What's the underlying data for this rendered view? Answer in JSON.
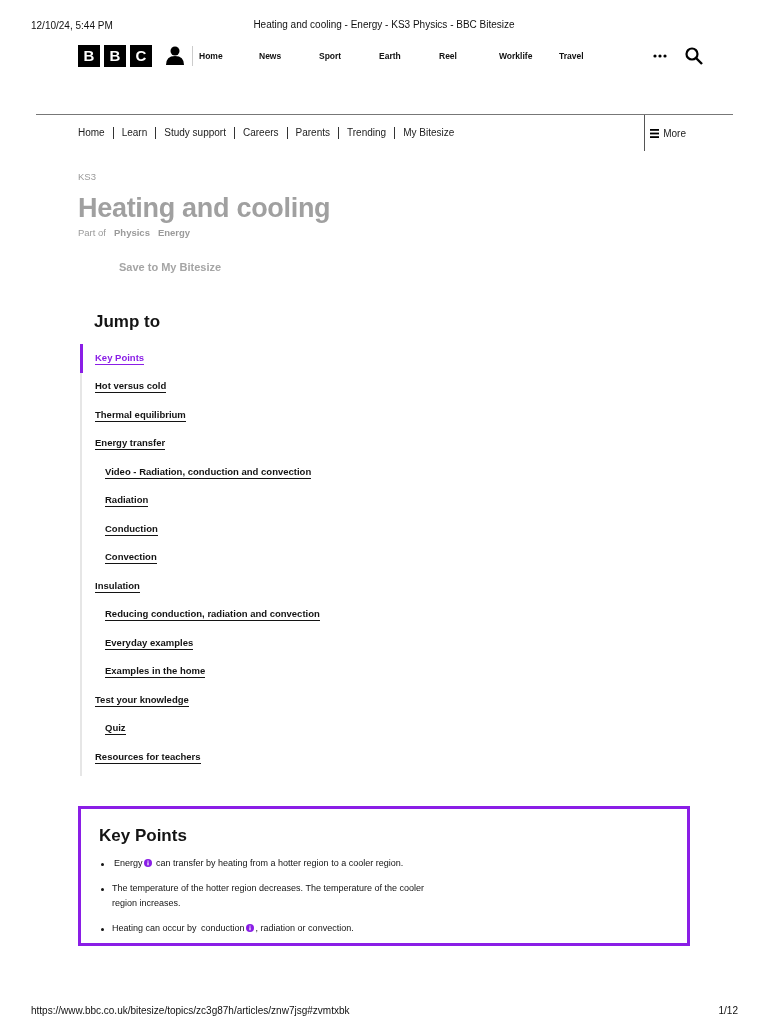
{
  "print_header": {
    "date": "12/10/24, 5:44 PM",
    "title": "Heating and cooling - Energy - KS3 Physics - BBC Bitesize"
  },
  "masthead": {
    "logo": [
      "B",
      "B",
      "C"
    ],
    "links": [
      "Home",
      "News",
      "Sport",
      "Earth",
      "Reel",
      "Worklife",
      "Travel"
    ]
  },
  "subnav": {
    "links": [
      "Home",
      "Learn",
      "Study support",
      "Careers",
      "Parents",
      "Trending",
      "My Bitesize"
    ],
    "more": "More"
  },
  "hero": {
    "level": "KS3",
    "title": "Heating and cooling",
    "part_of": "Part of",
    "topics": [
      "Physics",
      "Energy"
    ],
    "save": "Save to My Bitesize"
  },
  "jump_to": {
    "heading": "Jump to",
    "items": [
      {
        "label": "Key Points",
        "selected": true
      },
      {
        "label": "Hot versus cold",
        "selected": false
      },
      {
        "label": "Thermal equilibrium",
        "selected": false
      },
      {
        "label": "Energy transfer",
        "selected": false,
        "children": [
          {
            "label": "Video - Radiation, conduction and convection",
            "selected": false
          },
          {
            "label": "Radiation",
            "selected": false
          },
          {
            "label": "Conduction",
            "selected": false
          },
          {
            "label": "Convection",
            "selected": false
          }
        ]
      },
      {
        "label": "Insulation",
        "selected": false,
        "children": [
          {
            "label": "Reducing conduction, radiation and convection",
            "selected": false
          },
          {
            "label": "Everyday examples",
            "selected": false
          },
          {
            "label": "Examples in the home",
            "selected": false
          }
        ]
      },
      {
        "label": "Test your knowledge",
        "selected": false,
        "children": [
          {
            "label": "Quiz",
            "selected": false
          }
        ]
      },
      {
        "label": "Resources for teachers",
        "selected": false
      }
    ]
  },
  "key_points": {
    "heading": "Key Points",
    "bullets": [
      {
        "term": "Energy",
        "after": " can transfer by heating from a hotter region to a cooler region."
      },
      {
        "before": "The temperature of the hotter region decreases. The temperature of the cooler region increases."
      },
      {
        "before": "Heating can occur by ",
        "term": "conduction",
        "after": ", radiation or convection."
      }
    ]
  },
  "print_footer": {
    "url": "https://www.bbc.co.uk/bitesize/topics/zc3g87h/articles/znw7jsg#zvmtxbk",
    "page": "1/12"
  }
}
